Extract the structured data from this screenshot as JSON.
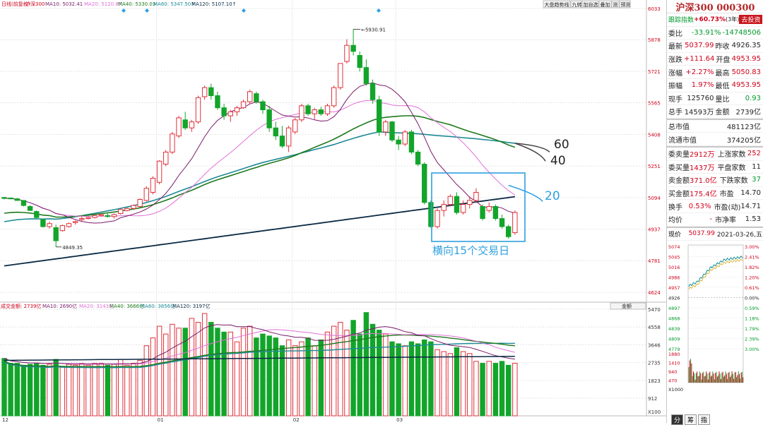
{
  "chart_data": {
    "type": "candlestick",
    "x_ticks": [
      "12",
      "01",
      "02",
      "03"
    ],
    "price_axis_ticks": [
      6033,
      5878,
      5721,
      5565,
      5408,
      5251,
      5094,
      4937,
      4781,
      4624
    ],
    "volume_axis_ticks": [
      5470,
      4558,
      3646,
      2735,
      1823,
      912
    ],
    "volume_unit": "X100",
    "high_annotation": "5930.91",
    "low_annotation": "4849.35",
    "ma_labels": {
      "ma60": "60",
      "ma40": "40",
      "ma20": "20"
    },
    "box_label": "横向15个交易日",
    "candles": [
      [
        5095,
        5097,
        5085,
        5090
      ],
      [
        5092,
        5095,
        5085,
        5088
      ],
      [
        5088,
        5092,
        5078,
        5080
      ],
      [
        5080,
        5080,
        5050,
        5055
      ],
      [
        5050,
        5056,
        5030,
        5030
      ],
      [
        5025,
        5030,
        4990,
        4995
      ],
      [
        4985,
        4990,
        4945,
        4950
      ],
      [
        4950,
        4975,
        4940,
        4965
      ],
      [
        4945,
        4960,
        4849,
        4880
      ],
      [
        4930,
        4960,
        4925,
        4955
      ],
      [
        4950,
        4970,
        4945,
        4965
      ],
      [
        4970,
        4980,
        4960,
        4975
      ],
      [
        4985,
        5000,
        4975,
        4990
      ],
      [
        4990,
        5000,
        4985,
        4995
      ],
      [
        4995,
        5010,
        4990,
        5005
      ],
      [
        5005,
        5015,
        5000,
        5010
      ],
      [
        5005,
        5015,
        4995,
        5000
      ],
      [
        5000,
        5015,
        4990,
        5010
      ],
      [
        5015,
        5040,
        5010,
        5035
      ],
      [
        5030,
        5045,
        5025,
        5040
      ],
      [
        5040,
        5060,
        5035,
        5055
      ],
      [
        5050,
        5090,
        5045,
        5085
      ],
      [
        5080,
        5150,
        5075,
        5140
      ],
      [
        5120,
        5200,
        5110,
        5190
      ],
      [
        5170,
        5280,
        5160,
        5275
      ],
      [
        5260,
        5330,
        5250,
        5320
      ],
      [
        5320,
        5420,
        5310,
        5410
      ],
      [
        5400,
        5500,
        5390,
        5490
      ],
      [
        5480,
        5520,
        5430,
        5440
      ],
      [
        5440,
        5480,
        5420,
        5470
      ],
      [
        5470,
        5600,
        5460,
        5590
      ],
      [
        5595,
        5650,
        5580,
        5640
      ],
      [
        5640,
        5660,
        5580,
        5600
      ],
      [
        5600,
        5620,
        5530,
        5540
      ],
      [
        5540,
        5560,
        5480,
        5500
      ],
      [
        5500,
        5530,
        5470,
        5520
      ],
      [
        5520,
        5550,
        5500,
        5540
      ],
      [
        5540,
        5580,
        5535,
        5570
      ],
      [
        5570,
        5630,
        5560,
        5620
      ],
      [
        5610,
        5620,
        5560,
        5570
      ],
      [
        5570,
        5580,
        5510,
        5530
      ],
      [
        5530,
        5550,
        5420,
        5440
      ],
      [
        5440,
        5470,
        5380,
        5400
      ],
      [
        5400,
        5450,
        5340,
        5350
      ],
      [
        5350,
        5450,
        5320,
        5440
      ],
      [
        5420,
        5490,
        5410,
        5480
      ],
      [
        5480,
        5560,
        5470,
        5550
      ],
      [
        5550,
        5560,
        5500,
        5510
      ],
      [
        5510,
        5540,
        5480,
        5530
      ],
      [
        5530,
        5545,
        5500,
        5510
      ],
      [
        5510,
        5560,
        5500,
        5550
      ],
      [
        5550,
        5650,
        5540,
        5640
      ],
      [
        5640,
        5760,
        5630,
        5760
      ],
      [
        5770,
        5880,
        5760,
        5850
      ],
      [
        5850,
        5930,
        5800,
        5820
      ],
      [
        5800,
        5820,
        5720,
        5740
      ],
      [
        5740,
        5780,
        5650,
        5660
      ],
      [
        5660,
        5680,
        5560,
        5580
      ],
      [
        5580,
        5600,
        5400,
        5420
      ],
      [
        5420,
        5480,
        5400,
        5470
      ],
      [
        5470,
        5475,
        5370,
        5380
      ],
      [
        5380,
        5400,
        5330,
        5360
      ],
      [
        5360,
        5430,
        5350,
        5420
      ],
      [
        5420,
        5430,
        5310,
        5320
      ],
      [
        5320,
        5330,
        5250,
        5260
      ],
      [
        5260,
        5270,
        5060,
        5070
      ],
      [
        5070,
        5080,
        4945,
        4950
      ],
      [
        4950,
        5040,
        4940,
        5030
      ],
      [
        5030,
        5080,
        5000,
        5060
      ],
      [
        5060,
        5110,
        5050,
        5100
      ],
      [
        5100,
        5120,
        5010,
        5020
      ],
      [
        5020,
        5080,
        5010,
        5060
      ],
      [
        5060,
        5100,
        5040,
        5080
      ],
      [
        5080,
        5140,
        5070,
        5120
      ],
      [
        5050,
        5060,
        4980,
        4990
      ],
      [
        5030,
        5070,
        5020,
        5050
      ],
      [
        5050,
        5060,
        4980,
        4990
      ],
      [
        4990,
        5010,
        4940,
        4950
      ],
      [
        4950,
        4960,
        4890,
        4900
      ],
      [
        4920,
        5030,
        4910,
        5020
      ]
    ],
    "volumes": [
      2950,
      2700,
      2700,
      2600,
      2650,
      2700,
      2600,
      2650,
      2900,
      2500,
      2650,
      2600,
      2700,
      2600,
      2700,
      2700,
      2600,
      2650,
      2900,
      2600,
      2700,
      2850,
      3600,
      4000,
      4600,
      4200,
      4700,
      4500,
      4500,
      5000,
      4800,
      5250,
      4800,
      4500,
      4300,
      4300,
      3800,
      4500,
      4600,
      4000,
      4200,
      4100,
      4000,
      3600,
      3900,
      3600,
      3800,
      4000,
      3600,
      3900,
      4300,
      4600,
      4800,
      4400,
      4900,
      4200,
      5300,
      4700,
      4400,
      4200,
      3800,
      3700,
      3600,
      3800,
      3700,
      3900,
      3800,
      3400,
      3300,
      3200,
      3500,
      3300,
      3200,
      2800,
      2700,
      2800,
      2700,
      2800,
      2600,
      2700
    ]
  },
  "ma_legend": {
    "main": "日线(前复权)",
    "name": "沪深300",
    "ma10": "MA10: 5032.41",
    "ma20": "MA20: 5120.87",
    "ma40": "MA40: 5330.03",
    "ma60": "MA60: 5347.50↑",
    "ma120": "MA120: 5107.10↑"
  },
  "vol_legend": {
    "name": "成交金额: 2739亿",
    "ma10": "MA10: 2690亿",
    "ma20": "MA20: 3143亿",
    "ma40": "MA40: 3666亿",
    "ma60": "MA60: 3856亿",
    "ma120": "MA120: 3197亿",
    "selector": "金额"
  },
  "toolbar": [
    "大盘趋势线",
    "九转",
    "加自选",
    "叠加",
    "测",
    "预测"
  ],
  "side": {
    "title": "沪深300 000300",
    "index_label": "跟踪指数",
    "index_value": "+60.73%",
    "index_period": "(3年)",
    "index_btn": "去投资",
    "rows": [
      {
        "k": "委比",
        "v1": "-33.91%",
        "c1": "grn",
        "v2": "-14748506",
        "c2": "grn"
      },
      {
        "k": "最新",
        "v1": "5037.99",
        "c1": "red",
        "k2": "昨收",
        "v2": "4926.35",
        "c2": "blk"
      },
      {
        "k": "涨跌",
        "v1": "+111.64",
        "c1": "red",
        "k2": "开盘",
        "v2": "4953.95",
        "c2": "red"
      },
      {
        "k": "涨幅",
        "v1": "+2.27%",
        "c1": "red",
        "k2": "最高",
        "v2": "5050.83",
        "c2": "red"
      },
      {
        "k": "振幅",
        "v1": "1.97%",
        "c1": "red",
        "k2": "最低",
        "v2": "4953.95",
        "c2": "red"
      },
      {
        "k": "现手",
        "v1": "125760",
        "c1": "blk",
        "k2": "量比",
        "v2": "0.93",
        "c2": "grn"
      },
      {
        "k": "总手",
        "v1": "14593万",
        "c1": "blk",
        "k2": "金额",
        "v2": "2739亿",
        "c2": "blk"
      }
    ],
    "mkt_rows": [
      {
        "k": "总市值",
        "v": "481123亿"
      },
      {
        "k": "流通市值",
        "v": "374205亿"
      }
    ],
    "trade_rows": [
      {
        "k": "委卖量",
        "v1": "2912万",
        "k2": "上涨家数",
        "v2": "252",
        "c2": "red"
      },
      {
        "k": "委买量",
        "v1": "1437万",
        "k2": "平盘家数",
        "v2": "11",
        "c2": "blk"
      },
      {
        "k": "卖金额",
        "v1": "371.0亿",
        "k2": "下跌家数",
        "v2": "37",
        "c2": "grn"
      },
      {
        "k": "买金额",
        "v1": "175.4亿",
        "k2": "市盈",
        "v2": "14.70",
        "c2": "blk"
      },
      {
        "k": "换手",
        "v1": "0.53%",
        "k2": "市盈(动)",
        "v2": "14.71",
        "c2": "blk"
      },
      {
        "k": "均价",
        "v1": "-",
        "k2": "市净率",
        "v2": "1.53",
        "c2": "blk"
      }
    ],
    "mini_header_label": "现价",
    "mini_header_price": "5037.99",
    "mini_header_date": "2021-03-26,五",
    "mini_left_ticks": [
      "5074",
      "5045",
      "5016",
      "4986",
      "4957",
      "4926",
      "4897",
      "4868",
      "4839",
      "4809",
      "4779",
      "1880",
      "1410",
      "940",
      "470"
    ],
    "mini_right_ticks": [
      "3.00%",
      "2.41%",
      "1.82%",
      "1.20%",
      "0.61%",
      "0.00%",
      "0.59%",
      "1.18%",
      "1.79%",
      "2.39%",
      "3.00%"
    ],
    "mini_unit": "X1000",
    "bottom_tabs": [
      "分",
      "筹",
      "指"
    ]
  }
}
